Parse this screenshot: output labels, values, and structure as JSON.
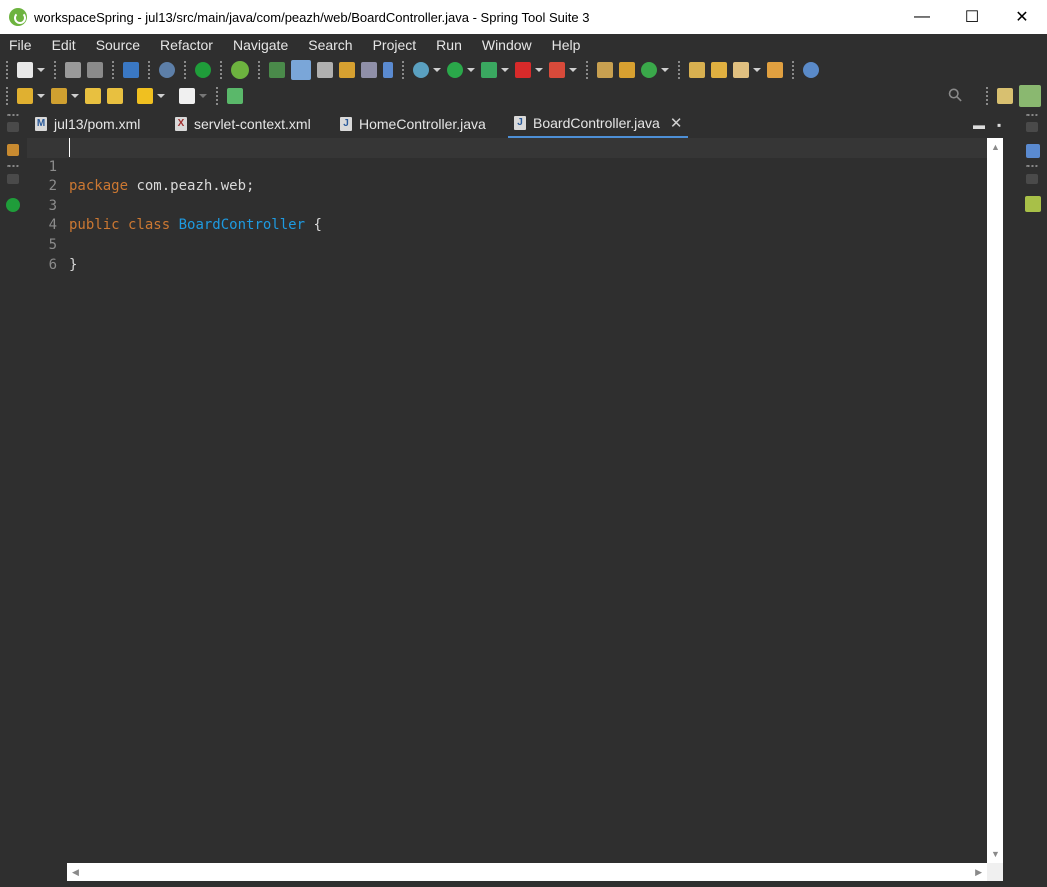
{
  "window": {
    "title": "workspaceSpring - jul13/src/main/java/com/peazh/web/BoardController.java - Spring Tool Suite 3",
    "minimize": "—",
    "maximize": "☐",
    "close": "✕"
  },
  "menu": [
    {
      "label": "File"
    },
    {
      "label": "Edit"
    },
    {
      "label": "Source"
    },
    {
      "label": "Refactor"
    },
    {
      "label": "Navigate"
    },
    {
      "label": "Search"
    },
    {
      "label": "Project"
    },
    {
      "label": "Run"
    },
    {
      "label": "Window"
    },
    {
      "label": "Help"
    }
  ],
  "tabs": [
    {
      "label": "jul13/pom.xml",
      "icon": "M"
    },
    {
      "label": "servlet-context.xml",
      "icon": "X"
    },
    {
      "label": "HomeController.java",
      "icon": "J"
    },
    {
      "label": "BoardController.java",
      "icon": "J",
      "close": "✕"
    }
  ],
  "editor": {
    "lines": [
      {
        "no": "1",
        "kw": "package",
        "text": " com.peazh.web;"
      },
      {
        "no": "2"
      },
      {
        "no": "3",
        "kw": "public class",
        "cls": "BoardController",
        "text": " {"
      },
      {
        "no": "4"
      },
      {
        "no": "5",
        "text": "}"
      },
      {
        "no": "6"
      }
    ]
  },
  "colors": {
    "keyword": "#cc7832",
    "classname": "#1e9ae0",
    "background": "#2f2f2f"
  },
  "icons": {
    "search": "⚲",
    "min": "▬",
    "max": "▪",
    "scroll_up": "▲",
    "scroll_down": "▼",
    "scroll_left": "◀",
    "scroll_right": "▶"
  }
}
